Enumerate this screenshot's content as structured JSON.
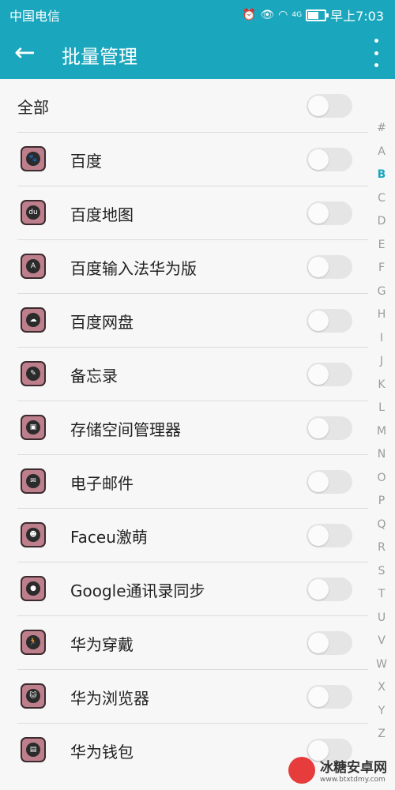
{
  "status_bar": {
    "carrier": "中国电信",
    "alarm_icon": "alarm-icon",
    "eye_icon": "eye-comfort-icon",
    "wifi_icon": "wifi-icon",
    "signal_label": "4G",
    "time": "早上7:03"
  },
  "app_bar": {
    "title": "批量管理",
    "back_icon": "back-arrow-icon",
    "more_icon": "more-vertical-icon"
  },
  "all_row": {
    "label": "全部",
    "enabled": false
  },
  "apps": [
    {
      "label": "百度",
      "icon": "paw-icon",
      "glyph": "🐾",
      "enabled": false
    },
    {
      "label": "百度地图",
      "icon": "map-pin-icon",
      "glyph": "du",
      "enabled": false
    },
    {
      "label": "百度输入法华为版",
      "icon": "keyboard-a-icon",
      "glyph": "A",
      "enabled": false
    },
    {
      "label": "百度网盘",
      "icon": "cloud-icon",
      "glyph": "☁",
      "enabled": false
    },
    {
      "label": "备忘录",
      "icon": "note-icon",
      "glyph": "✎",
      "enabled": false
    },
    {
      "label": "存储空间管理器",
      "icon": "storage-icon",
      "glyph": "▣",
      "enabled": false
    },
    {
      "label": "电子邮件",
      "icon": "mail-icon",
      "glyph": "✉",
      "enabled": false
    },
    {
      "label": "Faceu激萌",
      "icon": "face-icon",
      "glyph": "☻",
      "enabled": false
    },
    {
      "label": "Google通讯录同步",
      "icon": "contact-icon",
      "glyph": "●",
      "enabled": false
    },
    {
      "label": "华为穿戴",
      "icon": "runner-icon",
      "glyph": "🏃",
      "enabled": false
    },
    {
      "label": "华为浏览器",
      "icon": "browser-icon",
      "glyph": "🐱",
      "enabled": false
    },
    {
      "label": "华为钱包",
      "icon": "wallet-icon",
      "glyph": "▤",
      "enabled": false
    }
  ],
  "index_letters": [
    "#",
    "A",
    "B",
    "C",
    "D",
    "E",
    "F",
    "G",
    "H",
    "I",
    "J",
    "K",
    "L",
    "M",
    "N",
    "O",
    "P",
    "Q",
    "R",
    "S",
    "T",
    "U",
    "V",
    "W",
    "X",
    "Y",
    "Z"
  ],
  "active_letter": "B",
  "watermark": {
    "main": "冰糖安卓网",
    "sub": "www.btxtdmy.com"
  },
  "colors": {
    "accent": "#1aa6bd",
    "icon_fill": "#be7f8c"
  }
}
